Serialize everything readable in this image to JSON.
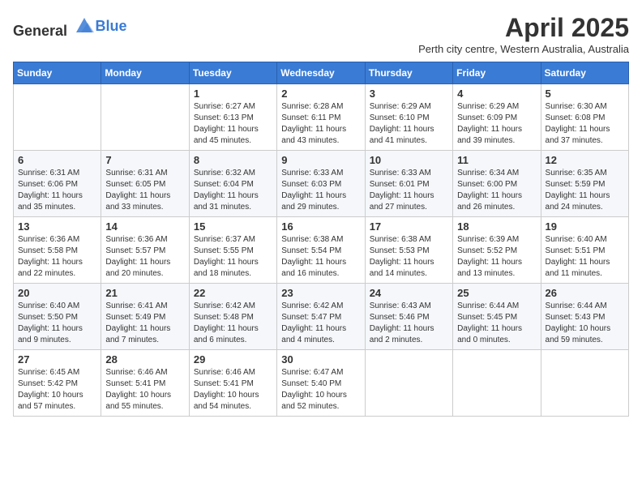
{
  "header": {
    "logo_general": "General",
    "logo_blue": "Blue",
    "month_title": "April 2025",
    "subtitle": "Perth city centre, Western Australia, Australia"
  },
  "weekdays": [
    "Sunday",
    "Monday",
    "Tuesday",
    "Wednesday",
    "Thursday",
    "Friday",
    "Saturday"
  ],
  "weeks": [
    [
      {
        "day": "",
        "info": ""
      },
      {
        "day": "",
        "info": ""
      },
      {
        "day": "1",
        "info": "Sunrise: 6:27 AM\nSunset: 6:13 PM\nDaylight: 11 hours and 45 minutes."
      },
      {
        "day": "2",
        "info": "Sunrise: 6:28 AM\nSunset: 6:11 PM\nDaylight: 11 hours and 43 minutes."
      },
      {
        "day": "3",
        "info": "Sunrise: 6:29 AM\nSunset: 6:10 PM\nDaylight: 11 hours and 41 minutes."
      },
      {
        "day": "4",
        "info": "Sunrise: 6:29 AM\nSunset: 6:09 PM\nDaylight: 11 hours and 39 minutes."
      },
      {
        "day": "5",
        "info": "Sunrise: 6:30 AM\nSunset: 6:08 PM\nDaylight: 11 hours and 37 minutes."
      }
    ],
    [
      {
        "day": "6",
        "info": "Sunrise: 6:31 AM\nSunset: 6:06 PM\nDaylight: 11 hours and 35 minutes."
      },
      {
        "day": "7",
        "info": "Sunrise: 6:31 AM\nSunset: 6:05 PM\nDaylight: 11 hours and 33 minutes."
      },
      {
        "day": "8",
        "info": "Sunrise: 6:32 AM\nSunset: 6:04 PM\nDaylight: 11 hours and 31 minutes."
      },
      {
        "day": "9",
        "info": "Sunrise: 6:33 AM\nSunset: 6:03 PM\nDaylight: 11 hours and 29 minutes."
      },
      {
        "day": "10",
        "info": "Sunrise: 6:33 AM\nSunset: 6:01 PM\nDaylight: 11 hours and 27 minutes."
      },
      {
        "day": "11",
        "info": "Sunrise: 6:34 AM\nSunset: 6:00 PM\nDaylight: 11 hours and 26 minutes."
      },
      {
        "day": "12",
        "info": "Sunrise: 6:35 AM\nSunset: 5:59 PM\nDaylight: 11 hours and 24 minutes."
      }
    ],
    [
      {
        "day": "13",
        "info": "Sunrise: 6:36 AM\nSunset: 5:58 PM\nDaylight: 11 hours and 22 minutes."
      },
      {
        "day": "14",
        "info": "Sunrise: 6:36 AM\nSunset: 5:57 PM\nDaylight: 11 hours and 20 minutes."
      },
      {
        "day": "15",
        "info": "Sunrise: 6:37 AM\nSunset: 5:55 PM\nDaylight: 11 hours and 18 minutes."
      },
      {
        "day": "16",
        "info": "Sunrise: 6:38 AM\nSunset: 5:54 PM\nDaylight: 11 hours and 16 minutes."
      },
      {
        "day": "17",
        "info": "Sunrise: 6:38 AM\nSunset: 5:53 PM\nDaylight: 11 hours and 14 minutes."
      },
      {
        "day": "18",
        "info": "Sunrise: 6:39 AM\nSunset: 5:52 PM\nDaylight: 11 hours and 13 minutes."
      },
      {
        "day": "19",
        "info": "Sunrise: 6:40 AM\nSunset: 5:51 PM\nDaylight: 11 hours and 11 minutes."
      }
    ],
    [
      {
        "day": "20",
        "info": "Sunrise: 6:40 AM\nSunset: 5:50 PM\nDaylight: 11 hours and 9 minutes."
      },
      {
        "day": "21",
        "info": "Sunrise: 6:41 AM\nSunset: 5:49 PM\nDaylight: 11 hours and 7 minutes."
      },
      {
        "day": "22",
        "info": "Sunrise: 6:42 AM\nSunset: 5:48 PM\nDaylight: 11 hours and 6 minutes."
      },
      {
        "day": "23",
        "info": "Sunrise: 6:42 AM\nSunset: 5:47 PM\nDaylight: 11 hours and 4 minutes."
      },
      {
        "day": "24",
        "info": "Sunrise: 6:43 AM\nSunset: 5:46 PM\nDaylight: 11 hours and 2 minutes."
      },
      {
        "day": "25",
        "info": "Sunrise: 6:44 AM\nSunset: 5:45 PM\nDaylight: 11 hours and 0 minutes."
      },
      {
        "day": "26",
        "info": "Sunrise: 6:44 AM\nSunset: 5:43 PM\nDaylight: 10 hours and 59 minutes."
      }
    ],
    [
      {
        "day": "27",
        "info": "Sunrise: 6:45 AM\nSunset: 5:42 PM\nDaylight: 10 hours and 57 minutes."
      },
      {
        "day": "28",
        "info": "Sunrise: 6:46 AM\nSunset: 5:41 PM\nDaylight: 10 hours and 55 minutes."
      },
      {
        "day": "29",
        "info": "Sunrise: 6:46 AM\nSunset: 5:41 PM\nDaylight: 10 hours and 54 minutes."
      },
      {
        "day": "30",
        "info": "Sunrise: 6:47 AM\nSunset: 5:40 PM\nDaylight: 10 hours and 52 minutes."
      },
      {
        "day": "",
        "info": ""
      },
      {
        "day": "",
        "info": ""
      },
      {
        "day": "",
        "info": ""
      }
    ]
  ]
}
